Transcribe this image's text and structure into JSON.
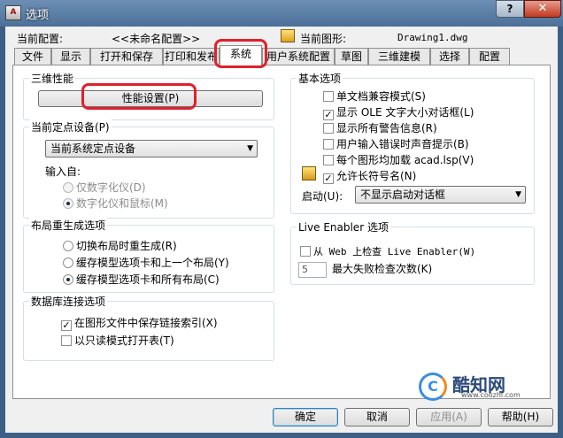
{
  "window": {
    "title": "选项",
    "app_icon_text": "A",
    "help_symbol": "?",
    "close_symbol": "✕"
  },
  "header": {
    "config_label": "当前配置:",
    "config_value": "<<未命名配置>>",
    "drawing_label": "当前图形:",
    "drawing_value": "Drawing1.dwg"
  },
  "tabs": [
    {
      "label": "文件",
      "active": false
    },
    {
      "label": "显示",
      "active": false
    },
    {
      "label": "打开和保存",
      "active": false
    },
    {
      "label": "打印和发布",
      "active": false
    },
    {
      "label": "系统",
      "active": true
    },
    {
      "label": "用户系统配置",
      "active": false
    },
    {
      "label": "草图",
      "active": false
    },
    {
      "label": "三维建模",
      "active": false
    },
    {
      "label": "选择",
      "active": false
    },
    {
      "label": "配置",
      "active": false
    }
  ],
  "perf3d": {
    "title": "三维性能",
    "button_label": "性能设置(P)"
  },
  "pointing": {
    "title": "当前定点设备(P)",
    "selected": "当前系统定点设备",
    "input_label": "输入自:",
    "options": [
      {
        "label": "仅数字化仪(D)",
        "checked": false
      },
      {
        "label": "数字化仪和鼠标(M)",
        "checked": true
      }
    ]
  },
  "layout_regen": {
    "title": "布局重生成选项",
    "options": [
      {
        "label": "切换布局时重生成(R)",
        "checked": false
      },
      {
        "label": "缓存模型选项卡和上一个布局(Y)",
        "checked": false
      },
      {
        "label": "缓存模型选项卡和所有布局(C)",
        "checked": true
      }
    ]
  },
  "dbconnect": {
    "title": "数据库连接选项",
    "options": [
      {
        "label": "在图形文件中保存链接索引(X)",
        "checked": true
      },
      {
        "label": "以只读模式打开表(T)",
        "checked": false
      }
    ]
  },
  "general": {
    "title": "基本选项",
    "options": [
      {
        "label": "单文档兼容模式(S)",
        "checked": false
      },
      {
        "label": "显示 OLE 文字大小对话框(L)",
        "checked": true
      },
      {
        "label": "显示所有警告信息(R)",
        "checked": false
      },
      {
        "label": "用户输入错误时声音提示(B)",
        "checked": false
      },
      {
        "label": "每个图形均加载 acad.lsp(V)",
        "checked": false
      },
      {
        "label": "允许长符号名(N)",
        "checked": true
      }
    ],
    "startup_label": "启动(U):",
    "startup_value": "不显示启动对话框"
  },
  "live": {
    "title": "Live Enabler 选项",
    "check_label": "从 Web 上检查 Live Enabler(W)",
    "checked": false,
    "max_fail_value": "5",
    "max_fail_label": "最大失败检查次数(K)"
  },
  "footer": {
    "ok": "确定",
    "cancel": "取消",
    "apply": "应用(A)",
    "help": "帮助(H)"
  },
  "watermark": {
    "logo_text": "C",
    "name": "酷知网",
    "url": "www.coozhi.com"
  },
  "icons": {
    "check": "✓",
    "dropdown": "▼"
  },
  "colors": {
    "highlight_ring": "#e0202c",
    "title_bar": "#4c7099"
  }
}
